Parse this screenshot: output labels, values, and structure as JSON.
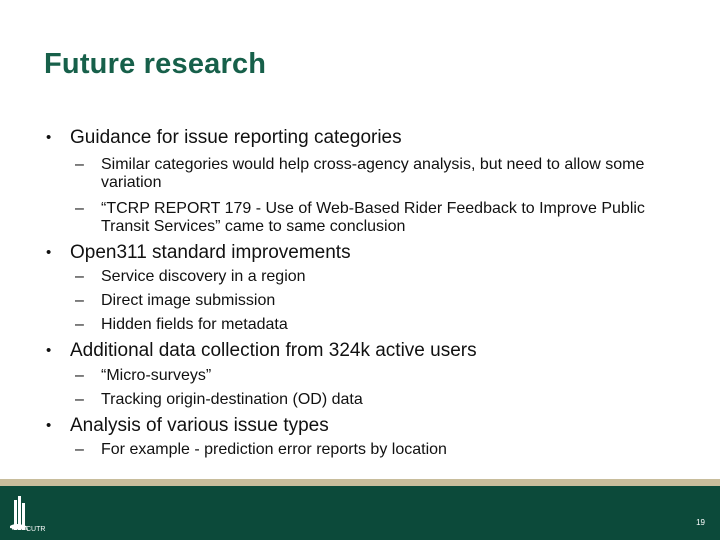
{
  "slide": {
    "title": "Future research",
    "page_number": "19"
  },
  "bullets": [
    {
      "text": "Guidance for issue reporting categories",
      "sub": [
        "Similar categories would help cross-agency analysis, but need to allow some variation",
        "“TCRP REPORT 179 - Use of Web-Based Rider Feedback to Improve Public Transit Services” came to same conclusion"
      ]
    },
    {
      "text": "Open311 standard improvements",
      "sub": [
        "Service discovery in a region",
        "Direct image submission",
        "Hidden fields for metadata"
      ]
    },
    {
      "text": "Additional data collection from 324k active users",
      "sub": [
        "“Micro-surveys”",
        "Tracking origin-destination (OD) data"
      ]
    },
    {
      "text": "Analysis of various issue types",
      "sub": [
        "For example - prediction error reports by location"
      ]
    }
  ],
  "markers": {
    "bullet": "•",
    "dash": "–"
  },
  "footer": {
    "logo_text": "CUTR",
    "colors": {
      "stripe": "#c8bd9c",
      "band": "#0c4a3a",
      "title": "#17604a"
    }
  }
}
